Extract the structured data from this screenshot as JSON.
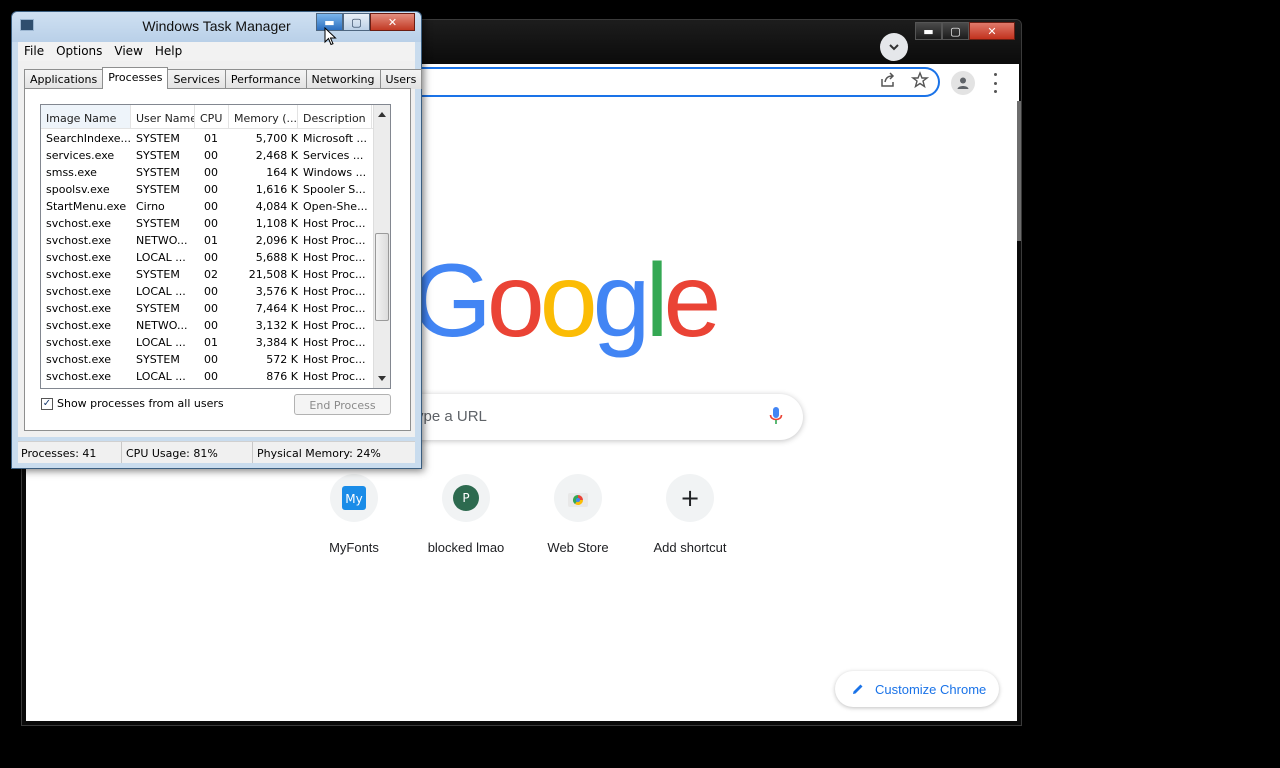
{
  "chrome": {
    "google_letters": [
      "G",
      "o",
      "o",
      "g",
      "l",
      "e"
    ],
    "google_colors": [
      "#4285f4",
      "#ea4335",
      "#fbbc05",
      "#4285f4",
      "#34a853",
      "#ea4335"
    ],
    "search_placeholder": "ype a URL",
    "shortcuts": [
      {
        "label": "MyFonts",
        "icon": "myfonts-icon"
      },
      {
        "label": "blocked lmao",
        "icon": "letter-p-avatar",
        "letter": "P"
      },
      {
        "label": "Web Store",
        "icon": "web-store-icon"
      },
      {
        "label": "Add shortcut",
        "icon": "plus-icon",
        "glyph": "+"
      }
    ],
    "customize_label": "Customize Chrome",
    "win_caps": {
      "minimize": "▬",
      "maximize": "▢",
      "close": "✕"
    }
  },
  "taskmgr": {
    "title": "Windows Task Manager",
    "menu": [
      "File",
      "Options",
      "View",
      "Help"
    ],
    "tabs": [
      "Applications",
      "Processes",
      "Services",
      "Performance",
      "Networking",
      "Users"
    ],
    "active_tab": "Processes",
    "columns": [
      "Image Name",
      "User Name",
      "CPU",
      "Memory (...",
      "Description"
    ],
    "rows": [
      [
        "SearchIndexe...",
        "SYSTEM",
        "01",
        "5,700 K",
        "Microsoft ..."
      ],
      [
        "services.exe",
        "SYSTEM",
        "00",
        "2,468 K",
        "Services ..."
      ],
      [
        "smss.exe",
        "SYSTEM",
        "00",
        "164 K",
        "Windows ..."
      ],
      [
        "spoolsv.exe",
        "SYSTEM",
        "00",
        "1,616 K",
        "Spooler S..."
      ],
      [
        "StartMenu.exe",
        "Cirno",
        "00",
        "4,084 K",
        "Open-She..."
      ],
      [
        "svchost.exe",
        "SYSTEM",
        "00",
        "1,108 K",
        "Host Proc..."
      ],
      [
        "svchost.exe",
        "NETWO...",
        "01",
        "2,096 K",
        "Host Proc..."
      ],
      [
        "svchost.exe",
        "LOCAL ...",
        "00",
        "5,688 K",
        "Host Proc..."
      ],
      [
        "svchost.exe",
        "SYSTEM",
        "02",
        "21,508 K",
        "Host Proc..."
      ],
      [
        "svchost.exe",
        "LOCAL ...",
        "00",
        "3,576 K",
        "Host Proc..."
      ],
      [
        "svchost.exe",
        "SYSTEM",
        "00",
        "7,464 K",
        "Host Proc..."
      ],
      [
        "svchost.exe",
        "NETWO...",
        "00",
        "3,132 K",
        "Host Proc..."
      ],
      [
        "svchost.exe",
        "LOCAL ...",
        "01",
        "3,384 K",
        "Host Proc..."
      ],
      [
        "svchost.exe",
        "SYSTEM",
        "00",
        "572 K",
        "Host Proc..."
      ],
      [
        "svchost.exe",
        "LOCAL ...",
        "00",
        "876 K",
        "Host Proc..."
      ]
    ],
    "show_all_label": "Show processes from all users",
    "show_all_checked": true,
    "end_process_label": "End Process",
    "status": {
      "processes": "Processes: 41",
      "cpu": "CPU Usage: 81%",
      "memory": "Physical Memory: 24%"
    },
    "win_caps": {
      "minimize": "▬",
      "maximize": "▢",
      "close": "✕"
    }
  }
}
